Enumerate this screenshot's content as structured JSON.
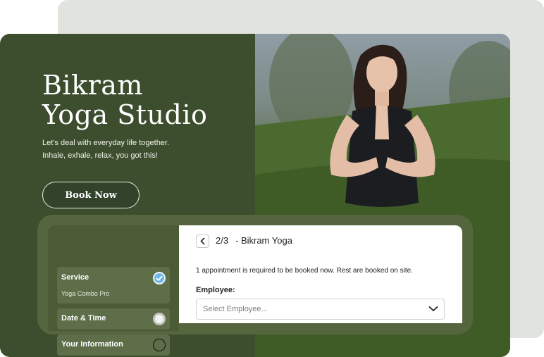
{
  "hero": {
    "title_line1": "Bikram",
    "title_line2": "Yoga Studio",
    "subtitle_line1": "Let's deal with everyday life together.",
    "subtitle_line2": "Inhale, exhale, relax, you got this!",
    "book_button": "Book Now"
  },
  "steps": [
    {
      "label": "Service",
      "value": "Yoga Combo Pro",
      "state": "completed"
    },
    {
      "label": "Date & Time",
      "state": "current"
    },
    {
      "label": "Your Information",
      "state": "pending"
    }
  ],
  "booking": {
    "step_counter": "2/3",
    "service_name": "- Bikram Yoga",
    "notice": "1 appointment is required to be booked now. Rest are booked on site.",
    "employee_label": "Employee:",
    "employee_placeholder": "Select Employee..."
  },
  "colors": {
    "primary_green": "#3d4e2e",
    "check_blue": "#6cb8e6"
  },
  "icons": {
    "back": "chevron-left-icon",
    "dropdown": "chevron-down-icon",
    "completed": "check-icon"
  }
}
